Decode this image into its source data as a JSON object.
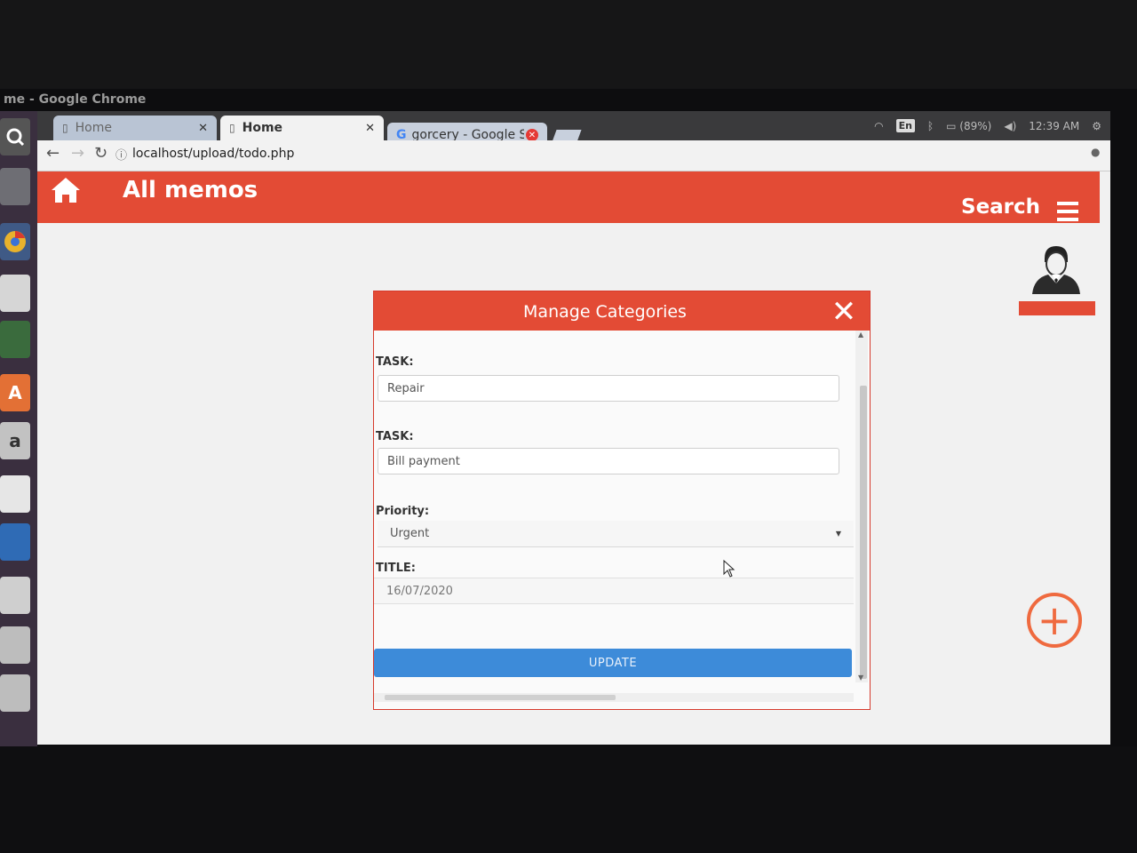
{
  "window": {
    "title": "me - Google Chrome"
  },
  "tabs": [
    {
      "label": "Home",
      "state": "inactive"
    },
    {
      "label": "Home",
      "state": "active"
    },
    {
      "label": "gorcery - Google Se",
      "state": "inactive"
    }
  ],
  "tray": {
    "lang": "En",
    "battery": "(89%)",
    "time": "12:39 AM"
  },
  "address_bar": {
    "url": "localhost/upload/todo.php"
  },
  "launcher": {
    "amazon_letter": "a",
    "software_letter": "A"
  },
  "app": {
    "title": "All memos",
    "search_label": "Search"
  },
  "modal": {
    "title": "Manage Categories",
    "close_glyph": "✕",
    "fields": {
      "task1": {
        "label": "TASK:",
        "value": "Repair"
      },
      "task2": {
        "label": "TASK:",
        "value": "Bill payment"
      },
      "priority": {
        "label": "Priority:",
        "value": "Urgent"
      },
      "title": {
        "label": "TITLE:",
        "value": "16/07/2020"
      }
    },
    "update_label": "UPDATE"
  },
  "fab": {
    "glyph": "+"
  },
  "colors": {
    "accent": "#e34b35",
    "button": "#3d8bd9",
    "fab": "#ef6a3f"
  }
}
